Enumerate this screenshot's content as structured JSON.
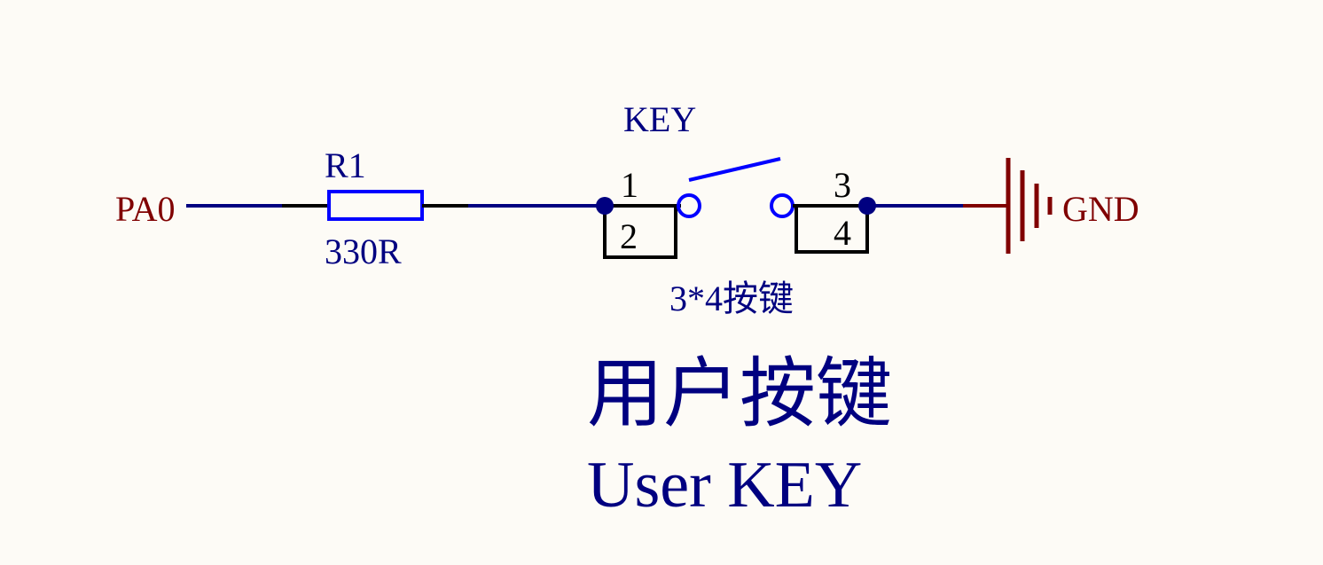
{
  "labels": {
    "net_pa0": "PA0",
    "resistor_designator": "R1",
    "resistor_value": "330R",
    "switch_designator": "KEY",
    "pin1": "1",
    "pin2": "2",
    "pin3": "3",
    "pin4": "4",
    "switch_footprint": "3*4按键",
    "net_gnd": "GND",
    "caption_cn": "用户按键",
    "caption_en": "User KEY"
  },
  "colors": {
    "background": "#fdfbf6",
    "wire": "#000080",
    "component_body": "#0000ff",
    "pin_line": "#000000",
    "junction": "#000080",
    "net_label": "#800000",
    "text": "#000080"
  }
}
